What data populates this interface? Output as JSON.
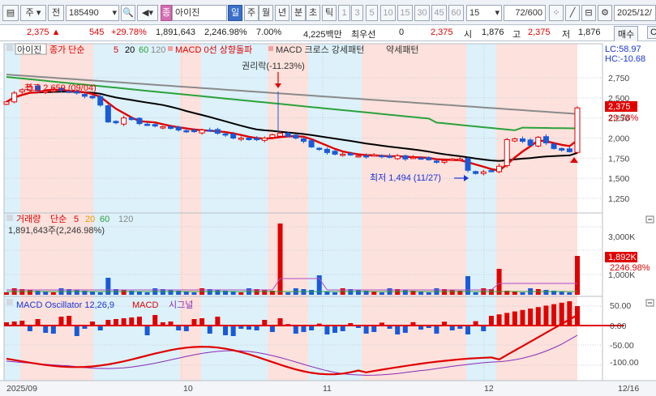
{
  "toolbar": {
    "mode": "주",
    "scope": "전",
    "code": "185490",
    "stock_name": "아이진",
    "stock_badge": "종",
    "periods": [
      "일",
      "주",
      "월",
      "년",
      "분",
      "초",
      "틱"
    ],
    "active_period": "일",
    "intervals": [
      "1",
      "3",
      "5",
      "10",
      "15",
      "30",
      "45",
      "60"
    ],
    "interval_value": "15",
    "count": "72",
    "count_total": "/600",
    "date": "2025/12/"
  },
  "quote": {
    "price": "2,375",
    "change": "545",
    "change_pct": "+29.78%",
    "volume": "1,891,643",
    "volume_ratio": "2,246.98%",
    "turnover": "7.00%",
    "amount": "4,225백만",
    "priority_label": "최우선",
    "priority_qty": "0",
    "priority_price": "2,375",
    "open_label": "시",
    "open": "1,876",
    "high_label": "고",
    "high": "2,375",
    "low_label": "저",
    "low": "1,876",
    "buy_label": "매수",
    "extra": "C"
  },
  "price_panel": {
    "legend_name": "아이진",
    "legend_ma": "종가 단순",
    "ma_periods": [
      "5",
      "20",
      "60",
      "120"
    ],
    "signal1": "MACD 0선 상향돌파",
    "signal2": "MACD 크로스 강세패턴",
    "signal3": "약세패턴",
    "lc": "LC:58.97",
    "hc": "HC:-10.68",
    "high_note": "최고 2,659 (09/04)",
    "low_note": "최저 1,494 (11/27)",
    "rights_note": "권리락(-11.23%)",
    "current_price": "2,375",
    "current_pct": "29.78%",
    "yticks": [
      "2,750",
      "2,500",
      "2,250",
      "2,000",
      "1,750",
      "1,500",
      "1,250"
    ]
  },
  "volume_panel": {
    "legend_name": "거래량",
    "legend_ma": "단순",
    "ma_periods": [
      "5",
      "20",
      "60",
      "120"
    ],
    "value_text": "1,891,643주(2,246.98%)",
    "current_volume": "1,892K",
    "current_pct": "2246.98%",
    "yticks": [
      "3,000K",
      "2,000K",
      "1,000K"
    ]
  },
  "macd_panel": {
    "legend_name": "MACD Oscillator 12,26,9",
    "legend_macd": "MACD",
    "legend_signal": "시그널",
    "yticks": [
      "50.00",
      "0.00",
      "-50.00",
      "-100.00"
    ]
  },
  "date_axis": {
    "labels": [
      "2025/09",
      "10",
      "11",
      "12"
    ],
    "right_label": "12/16"
  },
  "colors": {
    "up": "#e00000",
    "down": "#1a5ad8",
    "ma5": "#e00000",
    "ma20": "#000000",
    "ma60": "#2aa23a",
    "ma120": "#8a8a8a",
    "zone_pink": "#fde1dc",
    "zone_blue": "#dcf1fa"
  },
  "chart_data": {
    "type": "candlestick",
    "series": [
      {
        "name": "종가",
        "values": [
          2450,
          2560,
          2600,
          2640,
          2590,
          2580,
          2600,
          2590,
          2570,
          2560,
          2520,
          2500,
          2410,
          2200,
          2190,
          2250,
          2230,
          2180,
          2160,
          2150,
          2140,
          2120,
          2100,
          2090,
          2080,
          2100,
          2090,
          2060,
          2040,
          2000,
          2000,
          1980,
          1980,
          2000,
          2040,
          2060,
          2020,
          2000,
          1960,
          1890,
          1860,
          1820,
          1800,
          1800,
          1790,
          1780,
          1770,
          1790,
          1770,
          1760,
          1780,
          1740,
          1760,
          1750,
          1730,
          1700,
          1720,
          1740,
          1740,
          1600,
          1560,
          1580,
          1590,
          1650,
          1980,
          1990,
          1960,
          1910,
          2010,
          1940,
          1870,
          1850,
          1830,
          2375
        ]
      }
    ]
  }
}
